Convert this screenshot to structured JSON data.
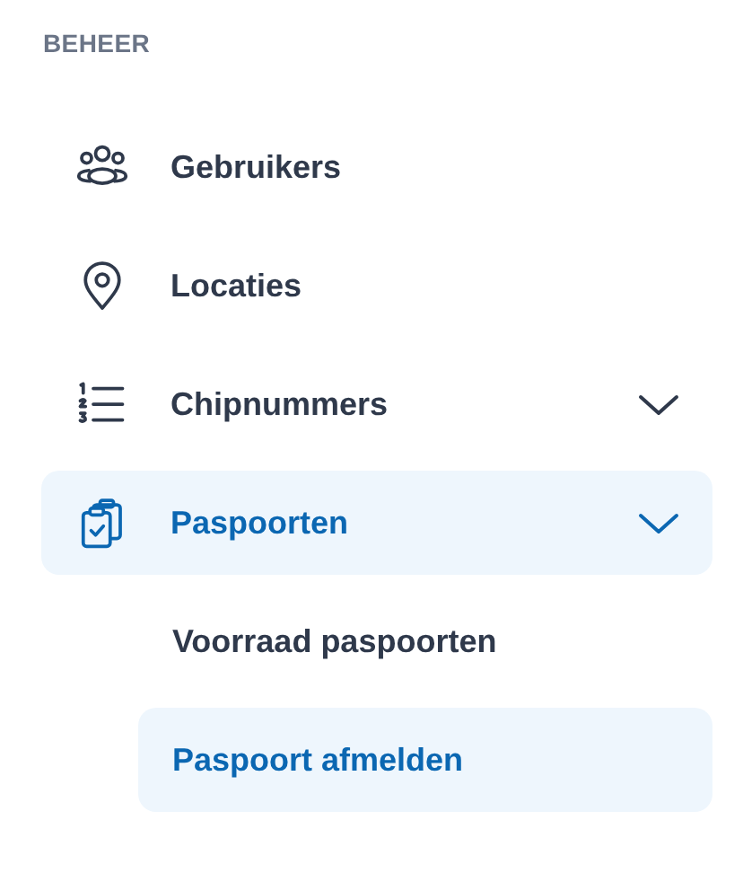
{
  "section": {
    "title": "BEHEER"
  },
  "items": [
    {
      "label": "Gebruikers",
      "selected": false,
      "collapsible": false
    },
    {
      "label": "Locaties",
      "selected": false,
      "collapsible": false
    },
    {
      "label": "Chipnummers",
      "selected": false,
      "collapsible": true
    },
    {
      "label": "Paspoorten",
      "selected": true,
      "collapsible": true,
      "expanded": true,
      "children": [
        {
          "label": "Voorraad paspoorten",
          "selected": false
        },
        {
          "label": "Paspoort afmelden",
          "selected": true
        }
      ]
    }
  ]
}
